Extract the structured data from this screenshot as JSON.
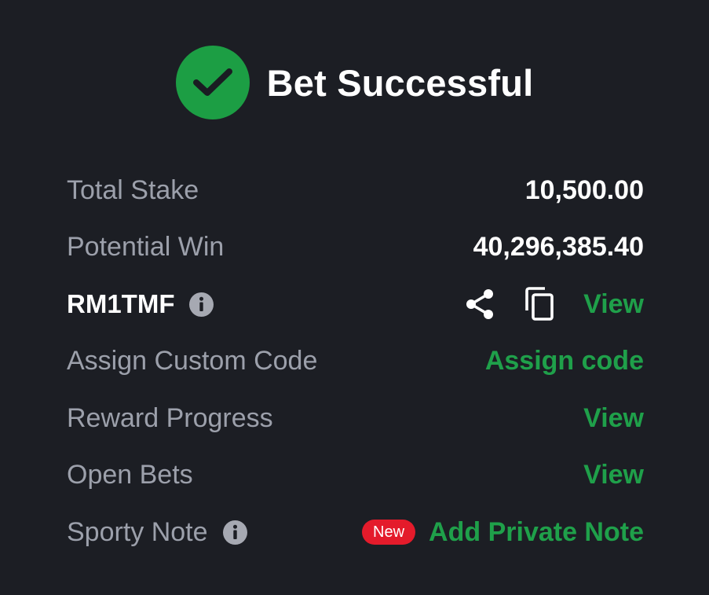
{
  "colors": {
    "background": "#1c1e24",
    "accent": "#1fa04a",
    "success_icon": "#1c9e44",
    "badge": "#e41b2b",
    "muted_text": "#9ca0ab"
  },
  "header": {
    "icon": "check-circle-icon",
    "title": "Bet Successful"
  },
  "rows": {
    "total_stake": {
      "label": "Total Stake",
      "value": "10,500.00"
    },
    "potential_win": {
      "label": "Potential Win",
      "value": "40,296,385.40"
    },
    "booking_code": {
      "label": "RM1TMF",
      "info_icon": "info-icon",
      "share_icon": "share-icon",
      "copy_icon": "copy-icon",
      "view_label": "View"
    },
    "custom_code": {
      "label": "Assign Custom Code",
      "action_label": "Assign code"
    },
    "reward_progress": {
      "label": "Reward Progress",
      "action_label": "View"
    },
    "open_bets": {
      "label": "Open Bets",
      "action_label": "View"
    },
    "sporty_note": {
      "label": "Sporty Note",
      "info_icon": "info-icon",
      "badge": "New",
      "action_label": "Add Private Note"
    }
  }
}
